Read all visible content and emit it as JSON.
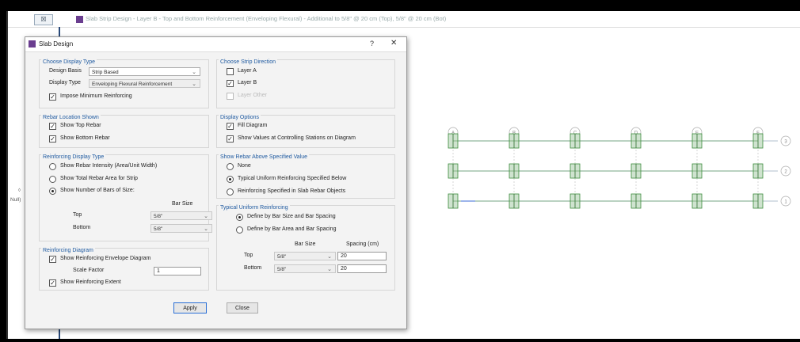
{
  "app": {
    "title": "Slab Strip Design - Layer B - Top and Bottom Reinforcement (Enveloping Flexural) - Additional to 5/8\" @ 20 cm (Top), 5/8\" @ 20 cm (Bot)",
    "restore_box": "☒",
    "side_label": "Null)"
  },
  "dialog": {
    "title": "Slab Design",
    "help": "?",
    "close": "✕",
    "display_type": {
      "title": "Choose Display Type",
      "design_basis_label": "Design Basis",
      "design_basis_value": "Strip Based",
      "display_type_label": "Display Type",
      "display_type_value": "Enveloping Flexural Reinforcement",
      "impose_min_label": "Impose Minimum Reinforcing"
    },
    "strip_direction": {
      "title": "Choose Strip Direction",
      "layer_a": "Layer A",
      "layer_b": "Layer B",
      "layer_other": "Layer Other"
    },
    "rebar_location": {
      "title": "Rebar Location Shown",
      "top": "Show Top Rebar",
      "bottom": "Show Bottom Rebar"
    },
    "display_options": {
      "title": "Display Options",
      "fill": "Fill Diagram",
      "show_values": "Show Values at Controlling Stations on Diagram"
    },
    "reinforcing_display": {
      "title": "Reinforcing Display Type",
      "intensity": "Show Rebar Intensity (Area/Unit Width)",
      "total_area": "Show Total Rebar Area for Strip",
      "num_bars": "Show Number of Bars of Size:",
      "bar_size_header": "Bar Size",
      "top_label": "Top",
      "top_value": "5/8\"",
      "bottom_label": "Bottom",
      "bottom_value": "5/8\""
    },
    "rebar_above": {
      "title": "Show Rebar Above Specified Value",
      "none": "None",
      "typical": "Typical Uniform Reinforcing Specified Below",
      "in_slab": "Reinforcing Specified in Slab Rebar Objects"
    },
    "typical_uniform": {
      "title": "Typical Uniform Reinforcing",
      "by_bar_size": "Define by Bar Size and Bar Spacing",
      "by_bar_area": "Define by Bar Area and Bar Spacing",
      "bar_size_header": "Bar Size",
      "spacing_header": "Spacing  (cm)",
      "top_label": "Top",
      "top_size": "5/8\"",
      "top_spacing": "20",
      "bottom_label": "Bottom",
      "bottom_size": "5/8\"",
      "bottom_spacing": "20"
    },
    "reinforcing_diagram": {
      "title": "Reinforcing Diagram",
      "show_envelope": "Show Reinforcing Envelope Diagram",
      "scale_factor_label": "Scale Factor",
      "scale_factor_value": "1",
      "show_extent": "Show Reinforcing Extent"
    },
    "apply": "Apply",
    "close_button": "Close"
  },
  "canvas": {
    "col_labels": [
      "A",
      "B",
      "C",
      "D",
      "E",
      "F"
    ],
    "row_labels": [
      "3",
      "2",
      "1"
    ]
  },
  "colors": {
    "accent": "#1f5aa0",
    "grid": "#3a8a3a"
  }
}
